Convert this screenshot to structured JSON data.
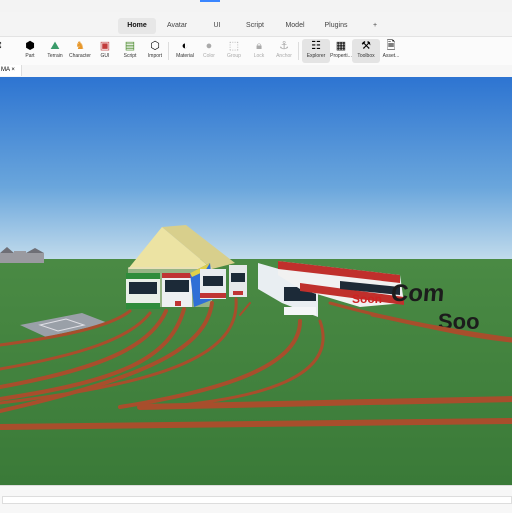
{
  "menu_tabs": [
    "Home",
    "Avatar",
    "UI",
    "Script",
    "Model",
    "Plugins"
  ],
  "menu_more": "+",
  "toolbar": [
    {
      "label": "Part",
      "icon": "part-icon"
    },
    {
      "label": "Terrain",
      "icon": "terrain-icon"
    },
    {
      "label": "Character",
      "icon": "character-icon"
    },
    {
      "label": "GUI",
      "icon": "gui-icon"
    },
    {
      "label": "Script",
      "icon": "script-icon"
    },
    {
      "label": "Import",
      "icon": "import-icon"
    },
    {
      "label": "Material",
      "icon": "material-icon"
    },
    {
      "label": "Color",
      "icon": "color-icon"
    },
    {
      "label": "Group",
      "icon": "group-icon"
    },
    {
      "label": "Lock",
      "icon": "lock-icon"
    },
    {
      "label": "Anchor",
      "icon": "anchor-icon"
    },
    {
      "label": "Explorer",
      "icon": "explorer-icon"
    },
    {
      "label": "Properti...",
      "icon": "properties-icon"
    },
    {
      "label": "Toolbox",
      "icon": "toolbox-icon"
    },
    {
      "label": "Asset...",
      "icon": "asset-manager-icon"
    }
  ],
  "document_tab": {
    "label": "MA",
    "close": "×"
  },
  "scene": {
    "sign_line1": "Com",
    "sign_line2": "Soo",
    "bus_label": "Soon",
    "colors": {
      "sky_top": "#2a72d0",
      "sky_bottom": "#bcd9ec",
      "grass": "#3f7d3c",
      "rail": "#a84e2c",
      "depot": "#efe6a8"
    }
  }
}
